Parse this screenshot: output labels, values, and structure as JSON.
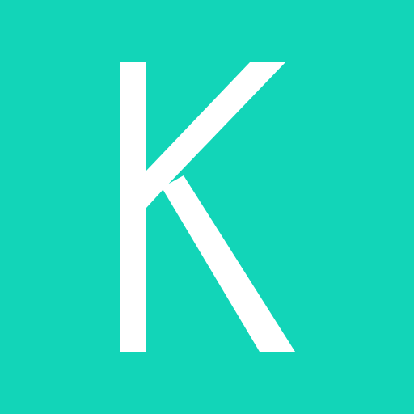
{
  "icon": {
    "letter": "K",
    "name": "k-logo-icon",
    "colors": {
      "background": "#12D5B8",
      "glyph": "#FFFFFF"
    }
  }
}
